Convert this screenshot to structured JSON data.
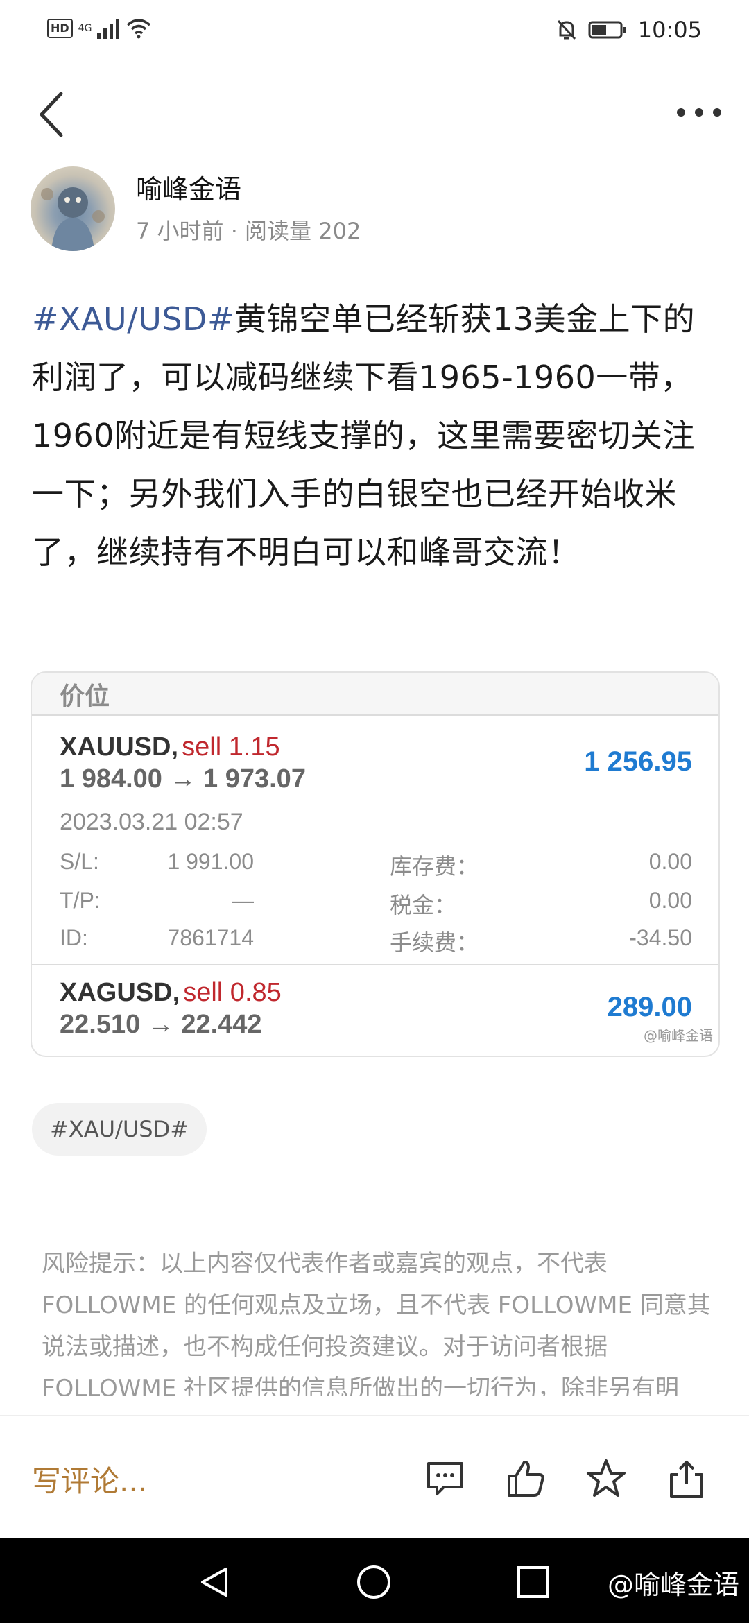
{
  "status_bar": {
    "hd": "HD",
    "network": "4G",
    "time": "10:05"
  },
  "author": {
    "name": "喻峰金语",
    "meta": "7 小时前 · 阅读量 202"
  },
  "post": {
    "tag": "#XAU/USD#",
    "text": "黄锦空单已经斩获13美金上下的利润了，可以减码继续下看1965-1960一带，1960附近是有短线支撑的，这里需要密切关注一下；另外我们入手的白银空也已经开始收米了，继续持有不明白可以和峰哥交流！"
  },
  "trade_card": {
    "header": "价位",
    "trades": [
      {
        "symbol": "XAUUSD,",
        "side": "sell 1.15",
        "prices": "1 984.00 → 1 973.07",
        "profit": "1 256.95",
        "date": "2023.03.21 02:57",
        "details": {
          "sl_label": "S/L:",
          "sl_value": "1 991.00",
          "tp_label": "T/P:",
          "tp_value": "—",
          "id_label": "ID:",
          "id_value": "7861714",
          "swap_label": "库存费：",
          "swap_value": "0.00",
          "tax_label": "税金：",
          "tax_value": "0.00",
          "fee_label": "手续费：",
          "fee_value": "-34.50"
        }
      },
      {
        "symbol": "XAGUSD,",
        "side": "sell 0.85",
        "prices": "22.510 → 22.442",
        "profit": "289.00"
      }
    ],
    "watermark": "@喻峰金语"
  },
  "topic": "#XAU/USD#",
  "disclaimer": "风险提示：以上内容仅代表作者或嘉宾的观点，不代表 FOLLOWME 的任何观点及立场，且不代表 FOLLOWME 同意其说法或描述，也不构成任何投资建议。对于访问者根据 FOLLOWME 社区提供的信息所做出的一切行为，除非另有明",
  "actions": {
    "comment_placeholder": "写评论..."
  },
  "nav_watermark": "@喻峰金语",
  "colors": {
    "tag_blue": "#3d5a96",
    "profit_blue": "#1f7bd1",
    "sell_red": "#c0282e",
    "comment_brown": "#b07a35"
  },
  "icons": [
    "back-icon",
    "more-icon",
    "comment-icon",
    "like-icon",
    "star-icon",
    "share-icon",
    "nav-back-icon",
    "nav-home-icon",
    "nav-recents-icon"
  ]
}
